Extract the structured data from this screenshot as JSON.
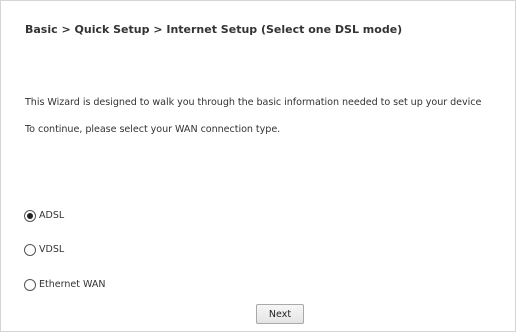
{
  "header": {
    "breadcrumb": "Basic > Quick Setup > Internet Setup (Select one DSL mode)"
  },
  "intro": {
    "line1": "This Wizard is designed to walk you through the basic information needed to set up your device",
    "line2": "To continue, please select your WAN connection type."
  },
  "wan_options": [
    {
      "label": "ADSL",
      "selected": true
    },
    {
      "label": "VDSL",
      "selected": false
    },
    {
      "label": "Ethernet WAN",
      "selected": false
    }
  ],
  "actions": {
    "next_label": "Next"
  }
}
